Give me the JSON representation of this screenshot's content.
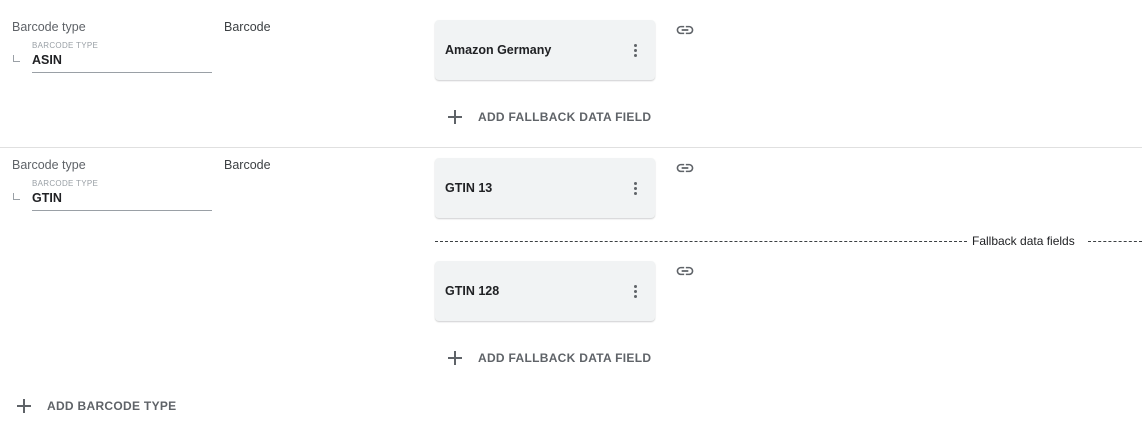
{
  "rows": [
    {
      "field_label": "Barcode type",
      "mini_label": "BARCODE TYPE",
      "value": "ASIN",
      "column_label": "Barcode",
      "cards": [
        {
          "title": "Amazon Germany"
        }
      ],
      "add_fallback_label": "ADD FALLBACK DATA FIELD"
    },
    {
      "field_label": "Barcode type",
      "mini_label": "BARCODE TYPE",
      "value": "GTIN",
      "column_label": "Barcode",
      "cards": [
        {
          "title": "GTIN 13"
        },
        {
          "title": "GTIN 128"
        }
      ],
      "fallback_separator_label": "Fallback data fields",
      "add_fallback_label": "ADD FALLBACK DATA FIELD"
    }
  ],
  "add_barcode_type_label": "ADD BARCODE TYPE",
  "icons": {
    "link": "link-icon",
    "more": "more-vert-icon",
    "add": "plus-icon"
  },
  "colors": {
    "card_background": "#f1f3f4",
    "secondary_text": "#5f6368"
  }
}
